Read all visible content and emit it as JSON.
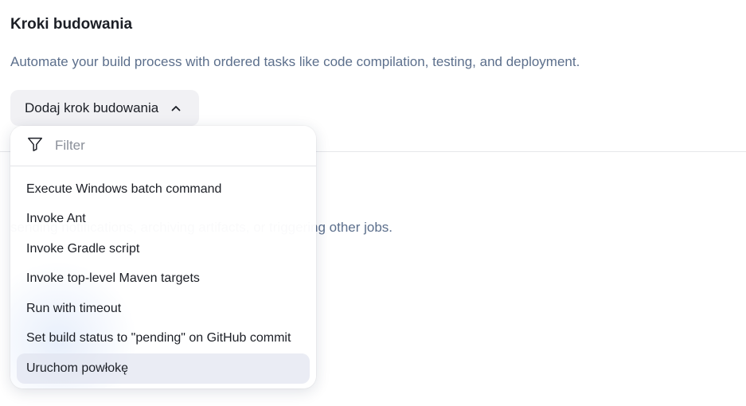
{
  "build_steps": {
    "title": "Kroki budowania",
    "description": "Automate your build process with ordered tasks like code compilation, testing, and deployment.",
    "add_button_label": "Dodaj krok budowania"
  },
  "post_build": {
    "description_visible": "sending notifications, archiving artifacts, or triggering other jobs."
  },
  "dropdown": {
    "filter_placeholder": "Filter",
    "filter_value": "",
    "items": [
      {
        "label": "Execute Windows batch command"
      },
      {
        "label": "Invoke Ant"
      },
      {
        "label": "Invoke Gradle script"
      },
      {
        "label": "Invoke top-level Maven targets"
      },
      {
        "label": "Run with timeout"
      },
      {
        "label": "Set build status to \"pending\" on GitHub commit"
      },
      {
        "label": "Uruchom powłokę"
      }
    ],
    "highlighted_item": "Uruchom powłokę"
  },
  "icons": {
    "filter": "filter-icon",
    "chevron": "chevron-up-icon"
  }
}
